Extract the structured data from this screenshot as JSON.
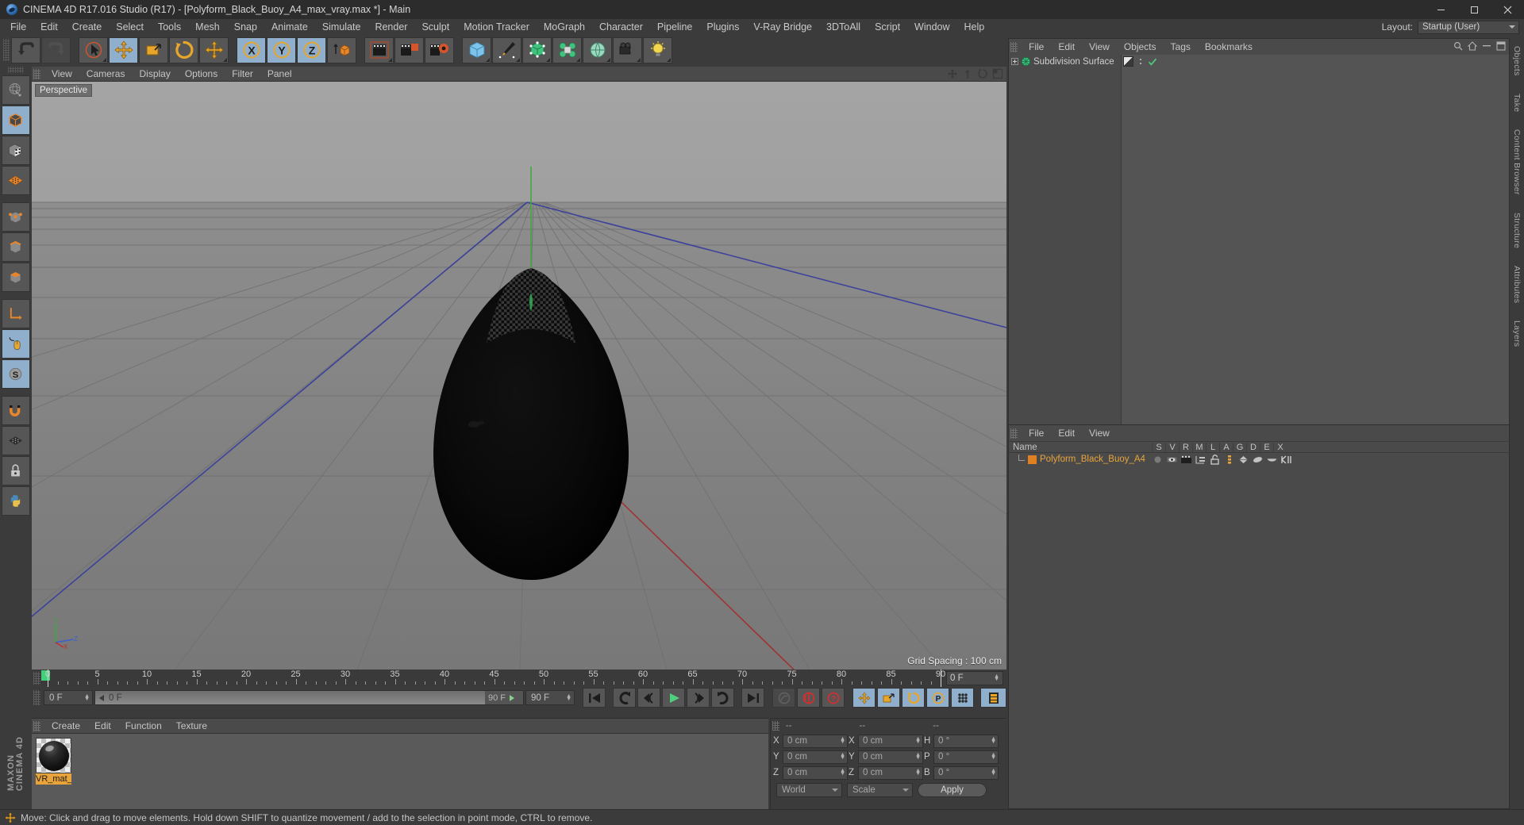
{
  "window": {
    "title": "CINEMA 4D R17.016 Studio (R17) - [Polyform_Black_Buoy_A4_max_vray.max *] - Main",
    "logo_icon": "cinema4d-logo-icon",
    "minimize_label": "–",
    "maximize_label": "❐",
    "close_label": "✕"
  },
  "menubar": {
    "items": [
      {
        "label": "File"
      },
      {
        "label": "Edit"
      },
      {
        "label": "Create"
      },
      {
        "label": "Select"
      },
      {
        "label": "Tools"
      },
      {
        "label": "Mesh"
      },
      {
        "label": "Snap"
      },
      {
        "label": "Animate"
      },
      {
        "label": "Simulate"
      },
      {
        "label": "Render"
      },
      {
        "label": "Sculpt"
      },
      {
        "label": "Motion Tracker"
      },
      {
        "label": "MoGraph"
      },
      {
        "label": "Character"
      },
      {
        "label": "Pipeline"
      },
      {
        "label": "Plugins"
      },
      {
        "label": "V-Ray Bridge"
      },
      {
        "label": "3DToAll"
      },
      {
        "label": "Script"
      },
      {
        "label": "Window"
      },
      {
        "label": "Help"
      }
    ],
    "layout_label": "Layout:",
    "layout_value": "Startup (User)"
  },
  "toolbar": {
    "buttons": [
      {
        "name": "undo-button",
        "icon": "undo-arrow-icon",
        "state": "normal"
      },
      {
        "name": "redo-button",
        "icon": "redo-arrow-icon",
        "state": "disabled"
      },
      {
        "name": "live-selection-tool",
        "icon": "cursor-select-icon",
        "state": "normal"
      },
      {
        "name": "move-tool",
        "icon": "move-cross-icon",
        "state": "active"
      },
      {
        "name": "scale-tool",
        "icon": "scale-box-icon",
        "state": "normal"
      },
      {
        "name": "rotate-tool",
        "icon": "rotate-circle-icon",
        "state": "normal"
      },
      {
        "name": "move-secondary-tool",
        "icon": "move-cross-icon",
        "state": "normal"
      },
      {
        "name": "x-axis-lock",
        "icon": "x-axis-icon",
        "state": "active"
      },
      {
        "name": "y-axis-lock",
        "icon": "y-axis-icon",
        "state": "active"
      },
      {
        "name": "z-axis-lock",
        "icon": "z-axis-icon",
        "state": "active"
      },
      {
        "name": "world-object-coordinates",
        "icon": "world-cube-icon",
        "state": "normal"
      },
      {
        "name": "render-view",
        "icon": "render-clapper-icon",
        "state": "normal"
      },
      {
        "name": "render-region",
        "icon": "render-region-icon",
        "state": "normal"
      },
      {
        "name": "render-settings",
        "icon": "render-gear-icon",
        "state": "normal"
      },
      {
        "name": "add-cube-primitive",
        "icon": "cube-primitive-icon",
        "state": "normal"
      },
      {
        "name": "add-spline",
        "icon": "pen-spline-icon",
        "state": "normal"
      },
      {
        "name": "add-generator",
        "icon": "generator-cube-icon",
        "state": "normal"
      },
      {
        "name": "add-deformer",
        "icon": "deformer-icon",
        "state": "normal"
      },
      {
        "name": "add-environment",
        "icon": "environment-sphere-icon",
        "state": "normal"
      },
      {
        "name": "add-camera",
        "icon": "camera-icon",
        "state": "normal"
      },
      {
        "name": "add-light",
        "icon": "light-bulb-icon",
        "state": "normal"
      }
    ]
  },
  "lefttools": {
    "buttons": [
      {
        "name": "make-editable",
        "icon": "globe-wire-icon",
        "state": "normal"
      },
      {
        "name": "model-mode",
        "icon": "model-cube-icon",
        "state": "active"
      },
      {
        "name": "texture-mode",
        "icon": "texture-checker-cube-icon",
        "state": "normal"
      },
      {
        "name": "workplane-mode",
        "icon": "workplane-grid-icon",
        "state": "normal"
      },
      {
        "name": "points-mode",
        "icon": "points-cube-icon",
        "state": "normal"
      },
      {
        "name": "edges-mode",
        "icon": "edges-cube-icon",
        "state": "normal"
      },
      {
        "name": "polygons-mode",
        "icon": "polygons-cube-icon",
        "state": "normal"
      },
      {
        "name": "enable-axis-modification",
        "icon": "axis-L-icon",
        "state": "normal"
      },
      {
        "name": "viewport-solo",
        "icon": "mouse-icon",
        "state": "active"
      },
      {
        "name": "snap-settings",
        "icon": "snap-s-icon",
        "state": "active"
      },
      {
        "name": "magnet-tool",
        "icon": "magnet-icon",
        "state": "normal"
      },
      {
        "name": "workplane-toggle",
        "icon": "grid-plane-icon",
        "state": "normal"
      },
      {
        "name": "lock-workplane",
        "icon": "lock-icon",
        "state": "normal"
      },
      {
        "name": "python-console",
        "icon": "python-icon",
        "state": "normal"
      }
    ],
    "brand_line1": "MAXON",
    "brand_line2": "CINEMA 4D"
  },
  "viewport": {
    "menus": [
      {
        "label": "View"
      },
      {
        "label": "Cameras"
      },
      {
        "label": "Display"
      },
      {
        "label": "Options"
      },
      {
        "label": "Filter"
      },
      {
        "label": "Panel"
      }
    ],
    "nav_icons": [
      {
        "name": "move-view-icon"
      },
      {
        "name": "scale-view-icon"
      },
      {
        "name": "rotate-view-icon"
      },
      {
        "name": "maximize-view-icon"
      }
    ],
    "label": "Perspective",
    "grid_spacing": "Grid Spacing : 100 cm",
    "axis": {
      "y": "Y",
      "x": "X",
      "z": "Z"
    },
    "object_color": "#080808"
  },
  "timeline": {
    "labels": [
      "0",
      "5",
      "10",
      "15",
      "20",
      "25",
      "30",
      "35",
      "40",
      "45",
      "50",
      "55",
      "60",
      "65",
      "70",
      "75",
      "80",
      "85",
      "90"
    ],
    "values": [
      0,
      5,
      10,
      15,
      20,
      25,
      30,
      35,
      40,
      45,
      50,
      55,
      60,
      65,
      70,
      75,
      80,
      85,
      90
    ],
    "range_start": 0,
    "range_end": 90,
    "current_frame_marker": "0 F",
    "end_field": "0 F"
  },
  "animbar": {
    "current_frame": "0 F",
    "scrub_start": "0 F",
    "scrub_end": "90 F",
    "end_frame": "90 F",
    "buttons": [
      {
        "name": "go-to-start-button",
        "icon": "skip-back-icon",
        "state": "normal"
      },
      {
        "name": "previous-keyframe-button",
        "icon": "prev-key-icon",
        "state": "normal"
      },
      {
        "name": "step-back-button",
        "icon": "step-back-icon",
        "state": "normal"
      },
      {
        "name": "play-button",
        "icon": "play-icon",
        "state": "normal"
      },
      {
        "name": "step-forward-button",
        "icon": "step-forward-icon",
        "state": "normal"
      },
      {
        "name": "next-keyframe-button",
        "icon": "next-key-icon",
        "state": "normal"
      },
      {
        "name": "go-to-end-button",
        "icon": "skip-forward-icon",
        "state": "normal"
      },
      {
        "name": "record-active-objects-button",
        "icon": "record-disabled-icon",
        "state": "disabled"
      },
      {
        "name": "autokeying-button",
        "icon": "autokey-icon",
        "state": "normal"
      },
      {
        "name": "keyframe-selection-button",
        "icon": "key-question-icon",
        "state": "normal"
      },
      {
        "name": "position-key-button",
        "icon": "position-cross-icon",
        "state": "active"
      },
      {
        "name": "scale-key-button",
        "icon": "scale-key-icon",
        "state": "active"
      },
      {
        "name": "rotation-key-button",
        "icon": "rotation-key-icon",
        "state": "active"
      },
      {
        "name": "parameter-key-button",
        "icon": "param-p-icon",
        "state": "active"
      },
      {
        "name": "point-level-animation-button",
        "icon": "pla-dots-icon",
        "state": "active"
      },
      {
        "name": "timeline-button",
        "icon": "timeline-film-icon",
        "state": "active"
      }
    ]
  },
  "material_manager": {
    "menus": [
      {
        "label": "Create"
      },
      {
        "label": "Edit"
      },
      {
        "label": "Function"
      },
      {
        "label": "Texture"
      }
    ],
    "materials": [
      {
        "name": "VR_mat_",
        "preview": "black-glossy-sphere"
      }
    ]
  },
  "coordinate_manager": {
    "headers": [
      "--",
      "--",
      "--"
    ],
    "rows": [
      {
        "axis1": "X",
        "value1": "0 cm",
        "axis2": "X",
        "value2": "0 cm",
        "axis3": "H",
        "value3": "0 °"
      },
      {
        "axis1": "Y",
        "value1": "0 cm",
        "axis2": "Y",
        "value2": "0 cm",
        "axis3": "P",
        "value3": "0 °"
      },
      {
        "axis1": "Z",
        "value1": "0 cm",
        "axis2": "Z",
        "value2": "0 cm",
        "axis3": "B",
        "value3": "0 °"
      }
    ],
    "coord_system": "World",
    "transform_mode": "Scale",
    "apply_label": "Apply"
  },
  "object_manager": {
    "menus": [
      {
        "label": "File"
      },
      {
        "label": "Edit"
      },
      {
        "label": "View"
      },
      {
        "label": "Objects"
      },
      {
        "label": "Tags"
      },
      {
        "label": "Bookmarks"
      }
    ],
    "items": [
      {
        "label": "Subdivision Surface",
        "icon": "subdivision-surface-icon",
        "tag": "material-tag"
      }
    ],
    "header_icons": [
      {
        "name": "search-icon"
      },
      {
        "name": "home-icon"
      },
      {
        "name": "collapse-icon"
      },
      {
        "name": "panel-icon"
      }
    ]
  },
  "layer_manager": {
    "menus": [
      {
        "label": "File"
      },
      {
        "label": "Edit"
      },
      {
        "label": "View"
      }
    ],
    "columns": [
      "Name",
      "S",
      "V",
      "R",
      "M",
      "L",
      "A",
      "G",
      "D",
      "E",
      "X"
    ],
    "rows": [
      {
        "name": "Polyform_Black_Buoy_A4",
        "color": "#e08020",
        "icons": [
          "solo-dot-icon",
          "visible-eye-icon",
          "render-clapper-icon",
          "manager-icon",
          "lock-open-icon",
          "animation-icon",
          "generator-icon",
          "deformer-icon",
          "expression-icon",
          "xref-icon"
        ]
      }
    ]
  },
  "right_tabs": [
    {
      "label": "Objects"
    },
    {
      "label": "Take"
    },
    {
      "label": "Content Browser"
    },
    {
      "label": "Structure"
    },
    {
      "label": "Attributes"
    },
    {
      "label": "Layers"
    }
  ],
  "statusbar": {
    "icon": "move-tool-icon",
    "text": "Move: Click and drag to move elements. Hold down SHIFT to quantize movement / add to the selection in point mode, CTRL to remove."
  },
  "colors": {
    "accent_orange": "#e08020",
    "active_blue": "#8fafcd",
    "panel_bg": "#3b3b3b",
    "field_bg": "#4a4a4a",
    "green_marker": "#44d07a",
    "axis_x": "#c03030",
    "axis_y": "#30b030",
    "axis_z": "#3050c0"
  }
}
